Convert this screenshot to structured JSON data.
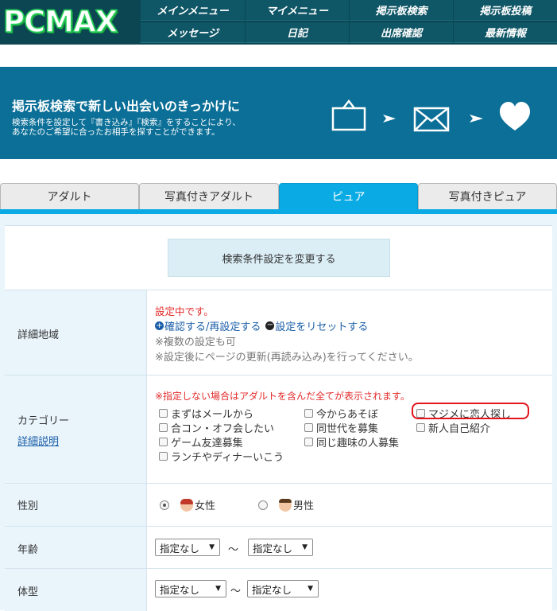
{
  "header": {
    "logo": "PCMAX",
    "nav": [
      "メインメニュー",
      "マイメニュー",
      "掲示板検索",
      "掲示板投稿",
      "メッセージ",
      "日記",
      "出席確認",
      "最新情報"
    ]
  },
  "banner": {
    "title": "掲示板検索で新しい出会いのきっかけに",
    "desc_line1": "検索条件を設定して『書き込み』『検索』をすることにより、",
    "desc_line2": "あなたのご希望に合ったお相手を探すことができます。",
    "icons": [
      "board-icon",
      "arrow-right-icon",
      "mail-icon",
      "arrow-right-icon",
      "heart-icon"
    ]
  },
  "tabs": [
    "アダルト",
    "写真付きアダルト",
    "ピュア",
    "写真付きピュア"
  ],
  "active_tab": "ピュア",
  "change_button": "検索条件設定を変更する",
  "area": {
    "label": "詳細地域",
    "status": "設定中です。",
    "confirm_link": "確認する/再設定する",
    "reset_link": "設定をリセットする",
    "note1": "※複数の設定も可",
    "note2": "※設定後にページの更新(再読み込み)を行ってください。"
  },
  "category": {
    "label": "カテゴリー",
    "detail_link": "詳細説明",
    "notice": "※指定しない場合はアダルトを含んだ全てが表示されます。",
    "options": [
      "まずはメールから",
      "今からあそぼ",
      "マジメに恋人探し",
      "合コン・オフ会したい",
      "同世代を募集",
      "新人自己紹介",
      "ゲーム友達募集",
      "同じ趣味の人募集",
      "ランチやディナーいこう"
    ]
  },
  "gender": {
    "label": "性別",
    "options": [
      "女性",
      "男性"
    ],
    "selected": "女性"
  },
  "age": {
    "label": "年齢",
    "from": "指定なし",
    "to": "指定なし",
    "separator": "～"
  },
  "body_type": {
    "label": "体型",
    "from": "指定なし",
    "to": "指定なし",
    "separator": "～"
  },
  "colors": {
    "header_bg": "#0b4652",
    "banner_bg": "#0b6f97",
    "active_tab": "#0aabe5",
    "logo_green": "#2ad35a",
    "highlight_red": "#e3141c"
  }
}
